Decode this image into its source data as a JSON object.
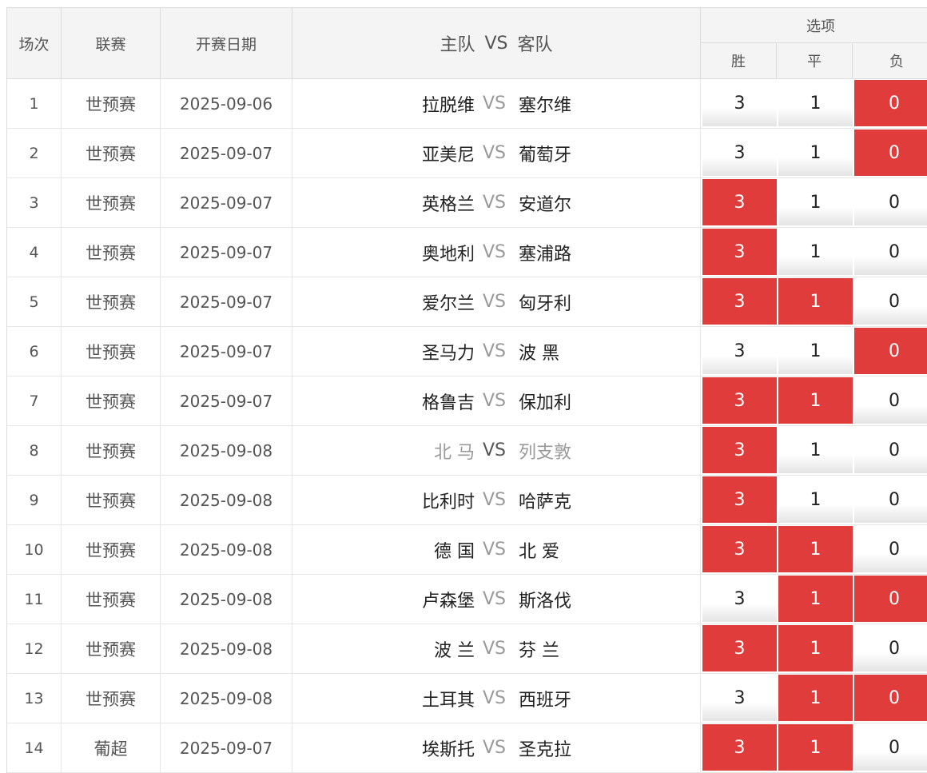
{
  "header": {
    "no": "场次",
    "league": "联赛",
    "date": "开赛日期",
    "home": "主队",
    "vs": "VS",
    "away": "客队",
    "options": "选项",
    "win": "胜",
    "draw": "平",
    "lose": "负"
  },
  "colors": {
    "selected": "#e03c3c",
    "header_bg": "#f4f4f4"
  },
  "rows": [
    {
      "no": "1",
      "league": "世预赛",
      "date": "2025-09-06",
      "home": "拉脱维",
      "away": "塞尔维",
      "w": "3",
      "d": "1",
      "l": "0",
      "sel": [
        false,
        false,
        true
      ]
    },
    {
      "no": "2",
      "league": "世预赛",
      "date": "2025-09-07",
      "home": "亚美尼",
      "away": "葡萄牙",
      "w": "3",
      "d": "1",
      "l": "0",
      "sel": [
        false,
        false,
        true
      ]
    },
    {
      "no": "3",
      "league": "世预赛",
      "date": "2025-09-07",
      "home": "英格兰",
      "away": "安道尔",
      "w": "3",
      "d": "1",
      "l": "0",
      "sel": [
        true,
        false,
        false
      ]
    },
    {
      "no": "4",
      "league": "世预赛",
      "date": "2025-09-07",
      "home": "奥地利",
      "away": "塞浦路",
      "w": "3",
      "d": "1",
      "l": "0",
      "sel": [
        true,
        false,
        false
      ]
    },
    {
      "no": "5",
      "league": "世预赛",
      "date": "2025-09-07",
      "home": "爱尔兰",
      "away": "匈牙利",
      "w": "3",
      "d": "1",
      "l": "0",
      "sel": [
        true,
        true,
        false
      ]
    },
    {
      "no": "6",
      "league": "世预赛",
      "date": "2025-09-07",
      "home": "圣马力",
      "away": "波 黑",
      "w": "3",
      "d": "1",
      "l": "0",
      "sel": [
        false,
        false,
        true
      ]
    },
    {
      "no": "7",
      "league": "世预赛",
      "date": "2025-09-07",
      "home": "格鲁吉",
      "away": "保加利",
      "w": "3",
      "d": "1",
      "l": "0",
      "sel": [
        true,
        true,
        false
      ]
    },
    {
      "no": "8",
      "league": "世预赛",
      "date": "2025-09-08",
      "home": "北 马",
      "away": "列支敦",
      "w": "3",
      "d": "1",
      "l": "0",
      "sel": [
        true,
        false,
        false
      ],
      "muted": true
    },
    {
      "no": "9",
      "league": "世预赛",
      "date": "2025-09-08",
      "home": "比利时",
      "away": "哈萨克",
      "w": "3",
      "d": "1",
      "l": "0",
      "sel": [
        true,
        false,
        false
      ]
    },
    {
      "no": "10",
      "league": "世预赛",
      "date": "2025-09-08",
      "home": "德 国",
      "away": "北 爱",
      "w": "3",
      "d": "1",
      "l": "0",
      "sel": [
        true,
        true,
        false
      ]
    },
    {
      "no": "11",
      "league": "世预赛",
      "date": "2025-09-08",
      "home": "卢森堡",
      "away": "斯洛伐",
      "w": "3",
      "d": "1",
      "l": "0",
      "sel": [
        false,
        true,
        true
      ]
    },
    {
      "no": "12",
      "league": "世预赛",
      "date": "2025-09-08",
      "home": "波 兰",
      "away": "芬 兰",
      "w": "3",
      "d": "1",
      "l": "0",
      "sel": [
        true,
        true,
        false
      ]
    },
    {
      "no": "13",
      "league": "世预赛",
      "date": "2025-09-08",
      "home": "土耳其",
      "away": "西班牙",
      "w": "3",
      "d": "1",
      "l": "0",
      "sel": [
        false,
        true,
        true
      ]
    },
    {
      "no": "14",
      "league": "葡超",
      "date": "2025-09-07",
      "home": "埃斯托",
      "away": "圣克拉",
      "w": "3",
      "d": "1",
      "l": "0",
      "sel": [
        true,
        true,
        false
      ]
    }
  ]
}
